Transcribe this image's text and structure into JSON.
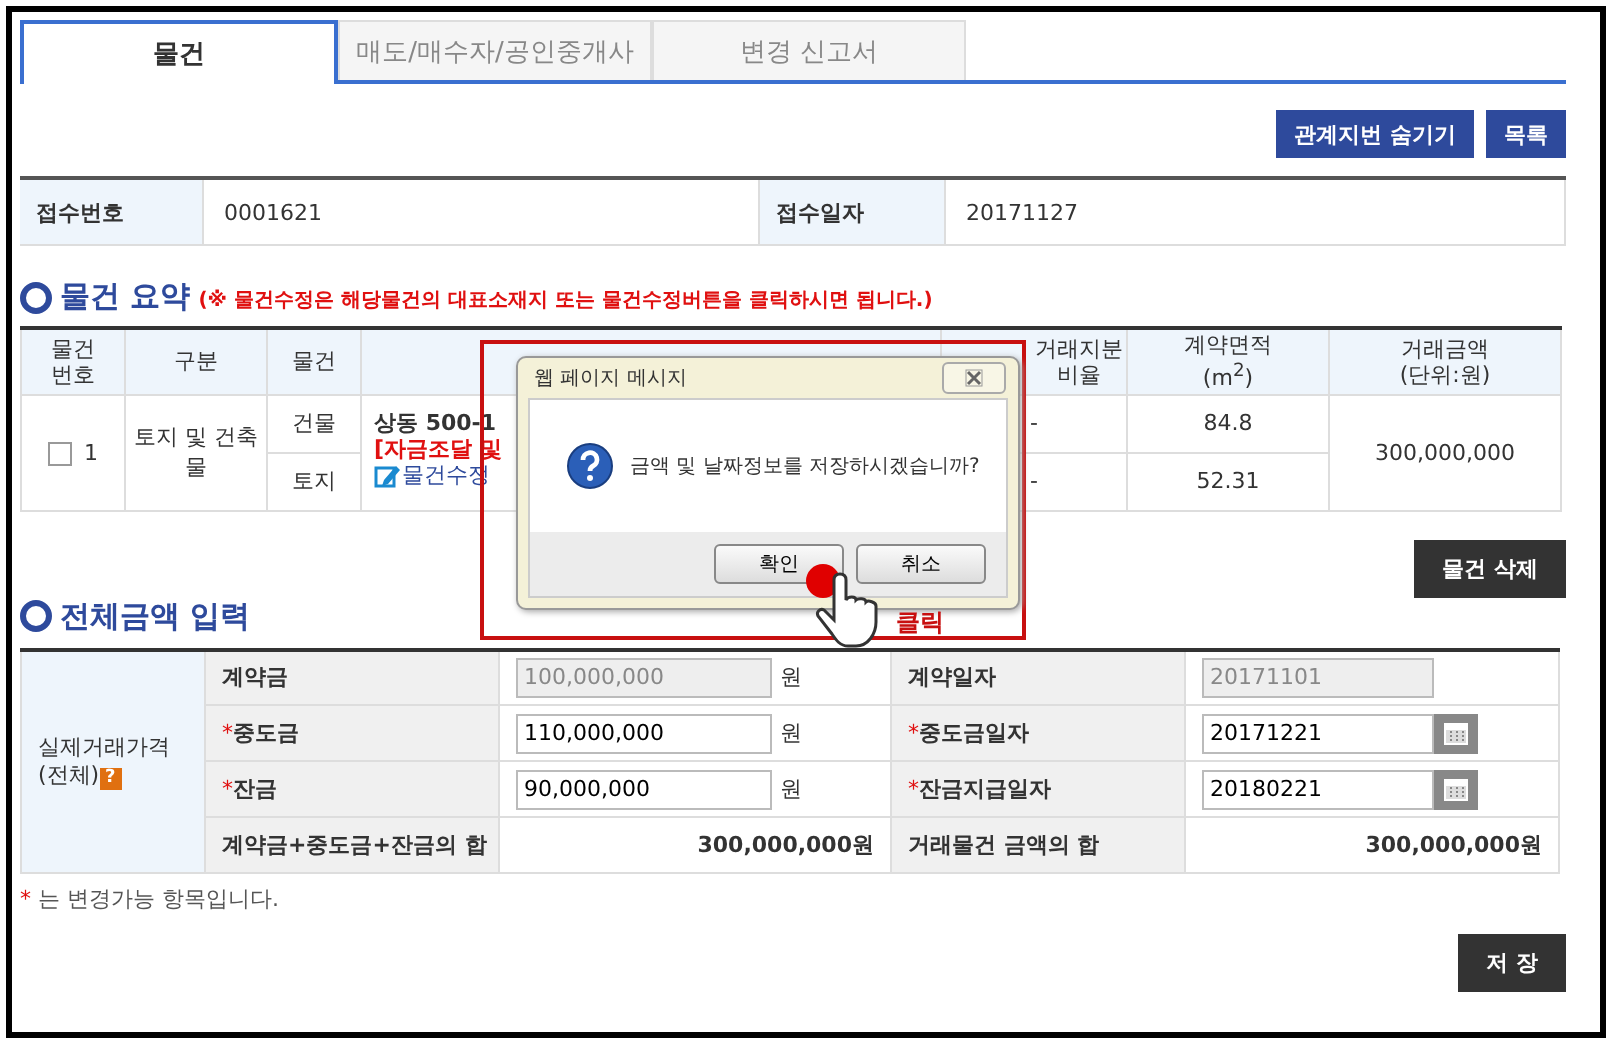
{
  "tabs": [
    {
      "label": "물건",
      "selected": true
    },
    {
      "label": "매도/매수자/공인중개사",
      "selected": false
    },
    {
      "label": "변경 신고서",
      "selected": false
    }
  ],
  "top_buttons": [
    "관계지번 숨기기",
    "목록"
  ],
  "receipt": [
    {
      "label": "접수번호",
      "value": "0001621"
    },
    {
      "label": "접수일자",
      "value": "20171127"
    }
  ],
  "summary": {
    "title": "물건 요약",
    "note": "(※ 물건수정은 해당물건의 대표소재지 또는 물건수정버튼을 클릭하시면 됩니다.)",
    "columns": [
      {
        "lines": [
          "물건",
          "번호"
        ]
      },
      {
        "lines": [
          "구분"
        ]
      },
      {
        "lines": [
          "물건"
        ]
      },
      {
        "blank": true
      },
      {
        "lines": [
          "거래지분",
          "비율"
        ]
      },
      {
        "lines": [
          "계약면적",
          "(m$^{2}$)"
        ]
      },
      {
        "lines": [
          "거래금액",
          "(단위:원)"
        ]
      }
    ],
    "rows": [
      {
        "checked": false,
        "number": "1",
        "category": "토지 및 건축물",
        "address": "상동 500-1",
        "note": "[자금조달 및",
        "edit_link": "물건수정",
        "amount": "300,000,000",
        "parts": [
          {
            "type": "건물",
            "share": "-",
            "area": "84.8"
          },
          {
            "type": "토지",
            "share": "-",
            "area": "52.31"
          }
        ]
      }
    ],
    "delete_button": "물건 삭제"
  },
  "amounts": {
    "title": "전체금액 입력",
    "group_label": "실제거래가격",
    "group_sub": "(전체)",
    "help": "?",
    "rows": [
      {
        "mark": "",
        "label": "계약금",
        "value": "100,000,000",
        "unit": "원",
        "disabled": true,
        "date_mark": "",
        "date_label": "계약일자",
        "date": "20171101",
        "date_disabled": true
      },
      {
        "mark": "*",
        "label": "중도금",
        "value": "110,000,000",
        "unit": "원",
        "disabled": false,
        "date_mark": "*",
        "date_label": "중도금일자",
        "date": "20171221",
        "date_disabled": false
      },
      {
        "mark": "*",
        "label": "잔금",
        "value": "90,000,000",
        "unit": "원",
        "disabled": false,
        "date_mark": "*",
        "date_label": "잔금지급일자",
        "date": "20180221",
        "date_disabled": false
      }
    ],
    "sum_label": "계약금+중도금+잔금의 합",
    "sum_value": "300,000,000원",
    "total_label": "거래물건 금액의 합",
    "total_value": "300,000,000원",
    "footnote_mark": "*",
    "footnote": "는 변경가능 항목입니다.",
    "save_button": "저 장"
  },
  "dialog": {
    "title": "웹 페이지 메시지",
    "message": "금액 및 날짜정보를 저장하시겠습니까?",
    "buttons": [
      "확인",
      "취소"
    ]
  },
  "annotation": {
    "label": "클릭"
  }
}
